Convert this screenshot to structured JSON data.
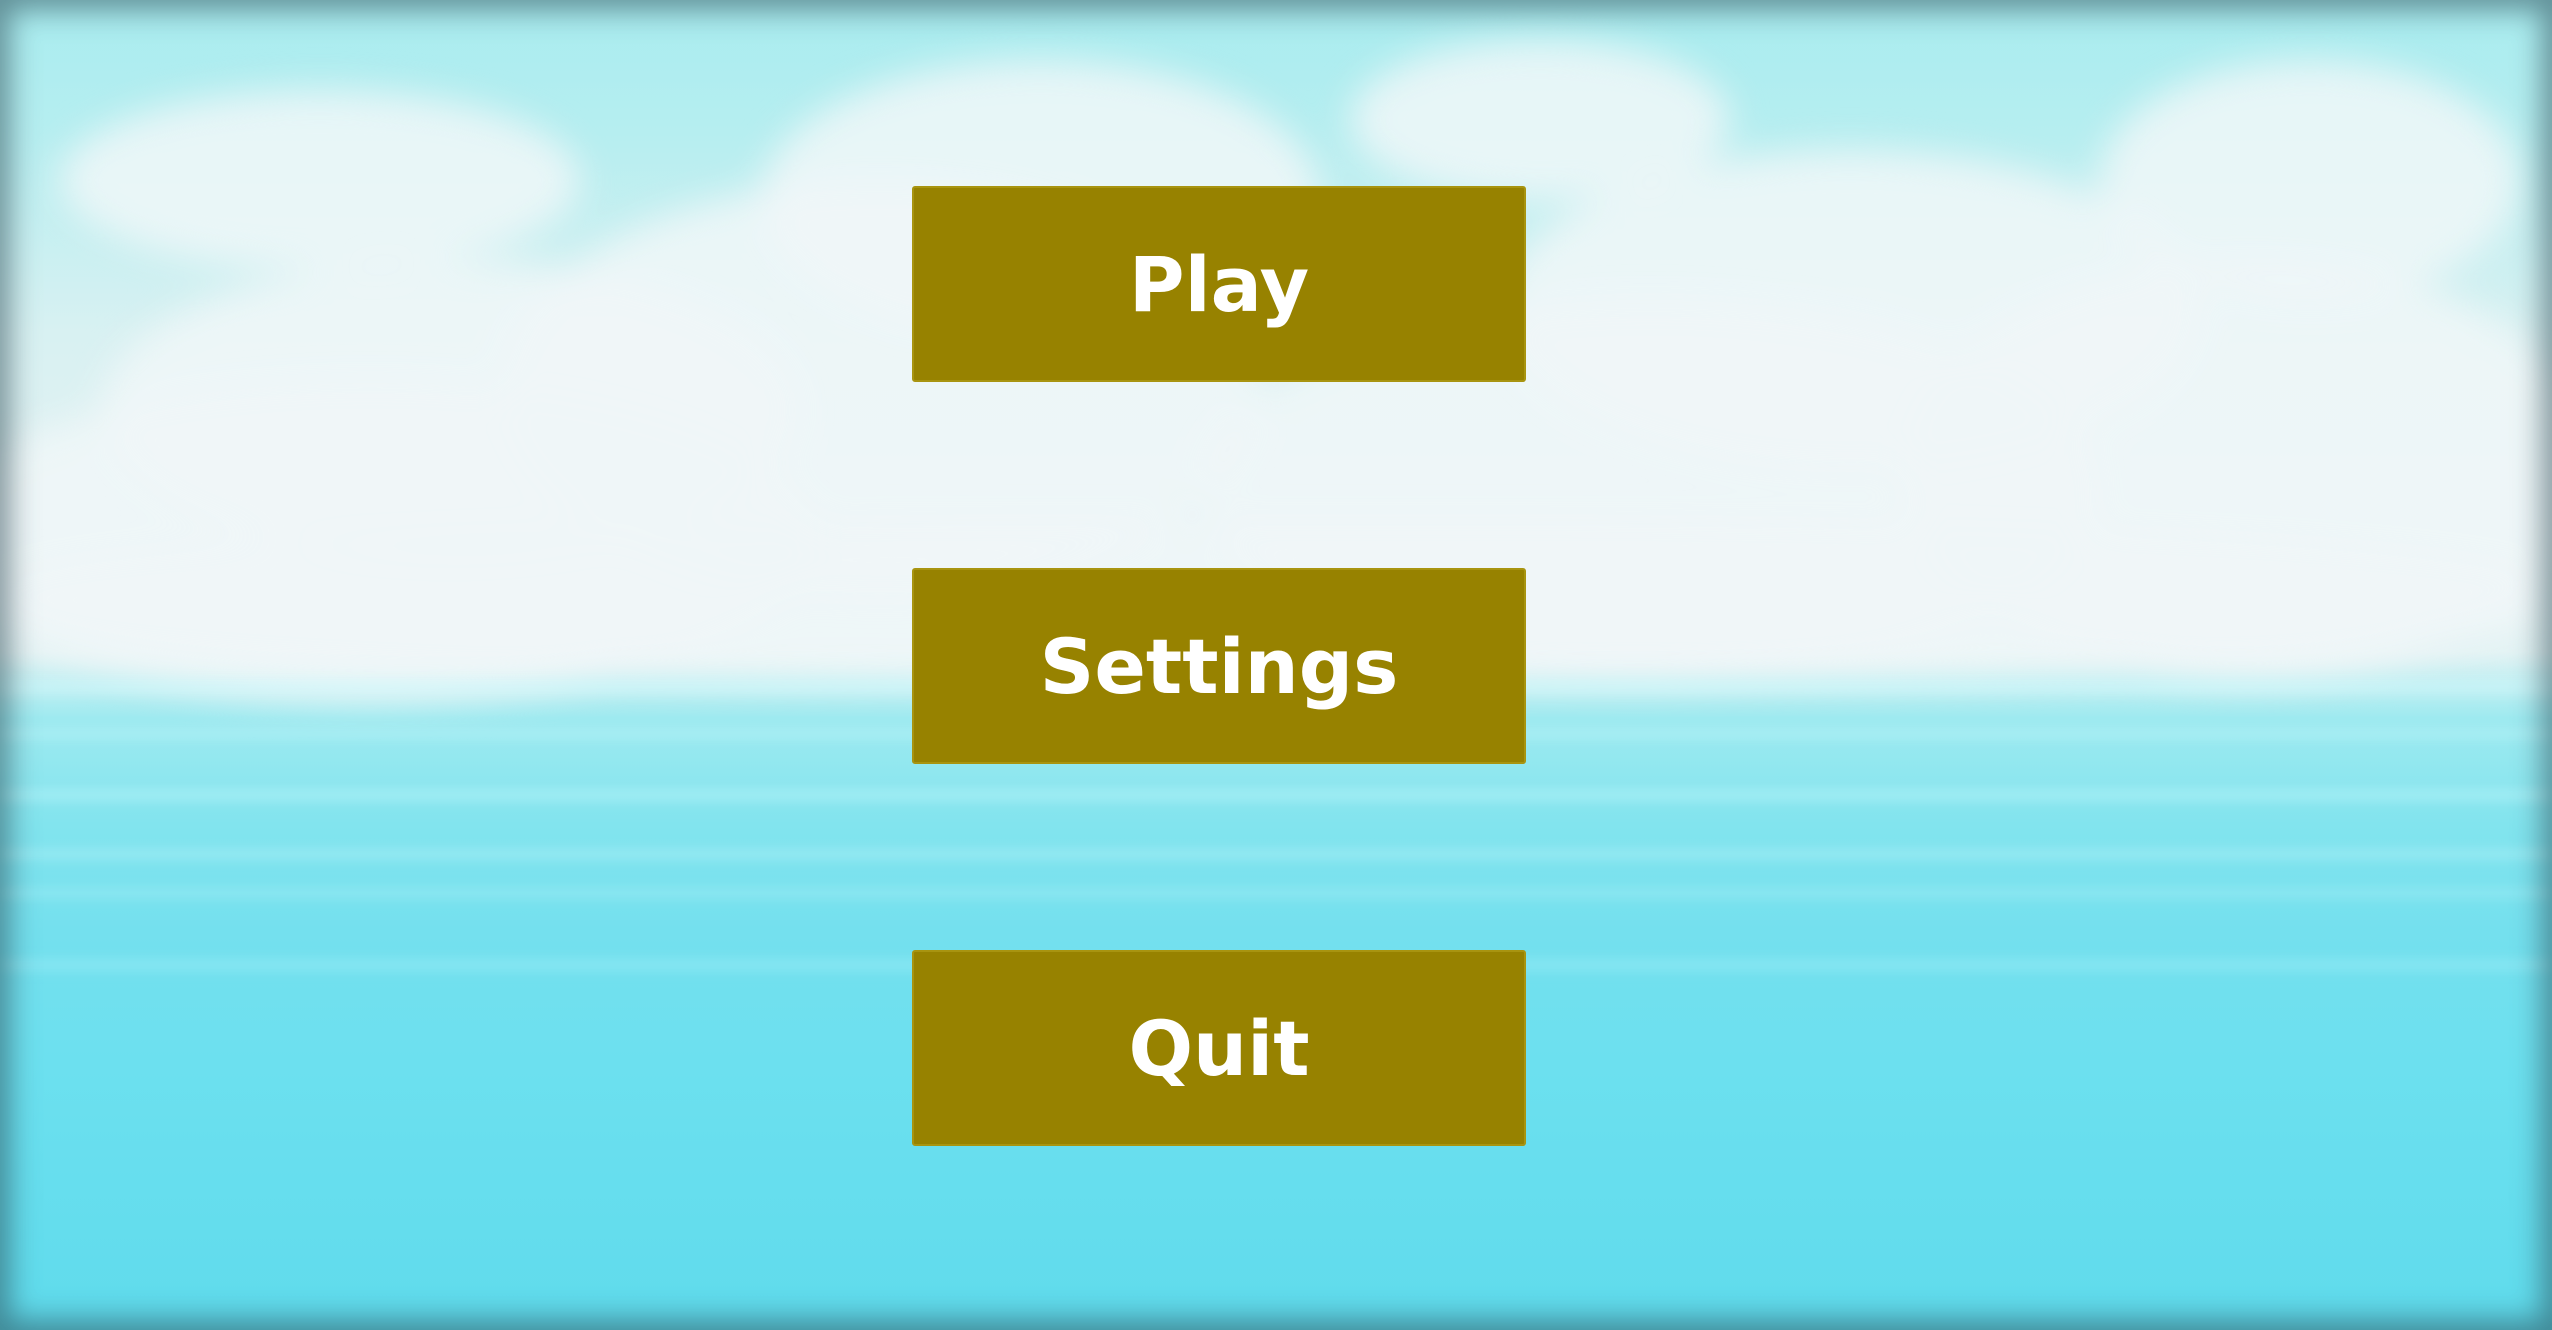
{
  "menu": {
    "play_label": "Play",
    "settings_label": "Settings",
    "quit_label": "Quit"
  },
  "colors": {
    "button_bg": "#978200",
    "button_text": "#ffffff",
    "sky": "#a8ecef",
    "clouds": "#e4f2f3",
    "sea": "#6ce0ef"
  }
}
